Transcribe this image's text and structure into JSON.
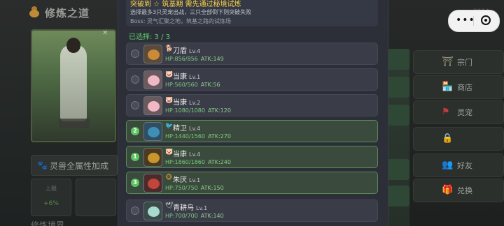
{
  "header": {
    "title": "修炼之道",
    "top_right": "2014"
  },
  "capsule": {
    "menu_glyph": "•••"
  },
  "left": {
    "attribute_bonus": "灵兽全属性加成",
    "cards": [
      {
        "label": "上限",
        "value": "+6%"
      },
      {
        "label": "",
        "value": ""
      }
    ],
    "bottom_label": "修炼境界"
  },
  "right_menu": [
    {
      "label": "宗门",
      "icon": "pagoda-icon"
    },
    {
      "label": "商店",
      "icon": "shop-icon"
    },
    {
      "label": "灵宠",
      "icon": "banner-icon"
    },
    {
      "label": "",
      "icon": "lock-icon"
    },
    {
      "label": "好友",
      "icon": "friend-icon"
    },
    {
      "label": "兑换",
      "icon": "gift-icon"
    }
  ],
  "modal": {
    "breakthrough": "突破到 ☆ 筑基期 需先通过秘境试炼",
    "rule": "选择最多3只灵宠出战，三只全部倒下则突破失败",
    "boss": "Boss: 灵气汇聚之地，筑基之路的试炼场",
    "selected": "已选择: 3 / 3",
    "pets": [
      {
        "name": "刀盾",
        "level": "Lv.4",
        "hp": "HP:856/856",
        "atk": "ATK:149",
        "selected": false,
        "order": "",
        "icon": "dog-icon",
        "color": "#c98a3a"
      },
      {
        "name": "当康",
        "level": "Lv.1",
        "hp": "HP:560/560",
        "atk": "ATK:56",
        "selected": false,
        "order": "",
        "icon": "pig-icon",
        "color": "#f0b7c4"
      },
      {
        "name": "当康",
        "level": "Lv.2",
        "hp": "HP:1080/1080",
        "atk": "ATK:120",
        "selected": false,
        "order": "",
        "icon": "pig-icon",
        "color": "#f0b7c4"
      },
      {
        "name": "精卫",
        "level": "Lv.4",
        "hp": "HP:1440/1560",
        "atk": "ATK:270",
        "selected": true,
        "order": "2",
        "icon": "bird-icon",
        "color": "#3d8fb8"
      },
      {
        "name": "当康",
        "level": "Lv.4",
        "hp": "HP:1860/1860",
        "atk": "ATK:240",
        "selected": true,
        "order": "1",
        "icon": "boar-icon",
        "color": "#c7962d"
      },
      {
        "name": "朱厌",
        "level": "Lv.1",
        "hp": "HP:750/750",
        "atk": "ATK:150",
        "selected": true,
        "order": "3",
        "icon": "monkey-icon",
        "color": "#c0463a"
      },
      {
        "name": "青耕鸟",
        "level": "Lv.1",
        "hp": "HP:700/700",
        "atk": "ATK:140",
        "selected": false,
        "order": "",
        "icon": "crane-icon",
        "color": "#a9d8d0"
      }
    ]
  }
}
